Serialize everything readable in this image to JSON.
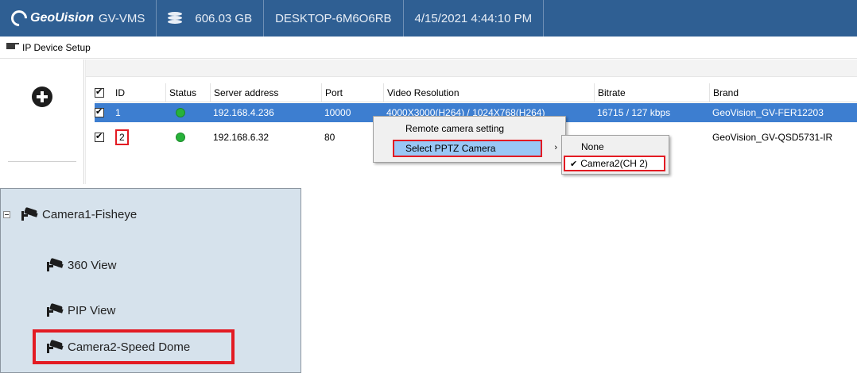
{
  "titlebar": {
    "logo_text": "GeoUision",
    "app_name": "GV-VMS",
    "storage": "606.03 GB",
    "host": "DESKTOP-6M6O6RB",
    "datetime": "4/15/2021 4:44:10 PM"
  },
  "menubar": {
    "label": "IP Device Setup"
  },
  "grid": {
    "headers": {
      "id": "ID",
      "status": "Status",
      "server": "Server address",
      "port": "Port",
      "resolution": "Video Resolution",
      "bitrate": "Bitrate",
      "brand": "Brand"
    },
    "rows": [
      {
        "id": "1",
        "server": "192.168.4.236",
        "port": "10000",
        "resolution": "4000X3000(H264) / 1024X768(H264)",
        "bitrate": "16715 / 127 kbps",
        "brand": "GeoVision_GV-FER12203",
        "checked": true,
        "selected": true
      },
      {
        "id": "2",
        "server": "192.168.6.32",
        "port": "80",
        "resolution": "",
        "bitrate": "",
        "brand": "GeoVision_GV-QSD5731-IR",
        "checked": true,
        "selected": false
      }
    ]
  },
  "context_menu": {
    "items": [
      "Remote camera setting",
      "Select PPTZ Camera"
    ],
    "submenu": [
      "None",
      "Camera2(CH 2)"
    ]
  },
  "tree": {
    "root": "Camera1-Fisheye",
    "children": [
      "360 View",
      "PIP View"
    ],
    "highlighted": "Camera2-Speed Dome"
  },
  "colors": {
    "titlebar_bg": "#2f5f93",
    "selection_bg": "#3d7ed0",
    "highlight_red": "#e31b23",
    "tree_bg": "#d6e2ec"
  }
}
